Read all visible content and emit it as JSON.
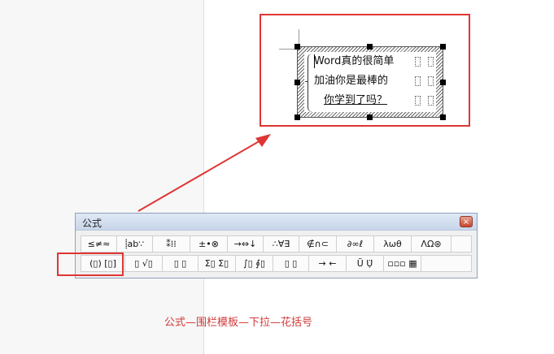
{
  "equation": {
    "lines": [
      "Word真的很简单",
      "加油你是最棒的",
      "你学到了吗？"
    ]
  },
  "dialog": {
    "title": "公式",
    "close_label": "×",
    "toolbar_row1": [
      {
        "name": "relational-symbols-button",
        "label": "≤≠≈"
      },
      {
        "name": "spaces-ellipses-button",
        "label": "⸽ab∵"
      },
      {
        "name": "embellishments-button",
        "label": "⁑⁞⁞"
      },
      {
        "name": "operator-symbols-button",
        "label": "±•⊗"
      },
      {
        "name": "arrow-symbols-button",
        "label": "→⇔↓"
      },
      {
        "name": "logical-symbols-button",
        "label": "∴∀∃"
      },
      {
        "name": "set-theory-symbols-button",
        "label": "∉∩⊂"
      },
      {
        "name": "misc-symbols-button",
        "label": "∂∞ℓ"
      },
      {
        "name": "greek-lowercase-button",
        "label": "λωθ"
      },
      {
        "name": "greek-uppercase-button",
        "label": "ΛΩ⊛"
      }
    ],
    "toolbar_row2": [
      {
        "name": "fence-templates-button",
        "label": "(▯) [▯]"
      },
      {
        "name": "fraction-radical-templates-button",
        "label": "▯ √▯"
      },
      {
        "name": "subscript-superscript-templates-button",
        "label": "▯ ▯"
      },
      {
        "name": "summation-templates-button",
        "label": "Σ▯ Σ▯"
      },
      {
        "name": "integral-templates-button",
        "label": "∫▯ ∮▯"
      },
      {
        "name": "underbar-overbar-templates-button",
        "label": "▯ ▯"
      },
      {
        "name": "labeled-arrow-templates-button",
        "label": "→ ←"
      },
      {
        "name": "products-set-theory-templates-button",
        "label": "Ũ Ụ̈"
      },
      {
        "name": "matrix-templates-button",
        "label": "▫▫▫ ▦"
      }
    ]
  },
  "caption": "公式—围栏模板—下拉—花括号",
  "colors": {
    "highlight": "#e03535",
    "caption": "#d23a3a"
  }
}
